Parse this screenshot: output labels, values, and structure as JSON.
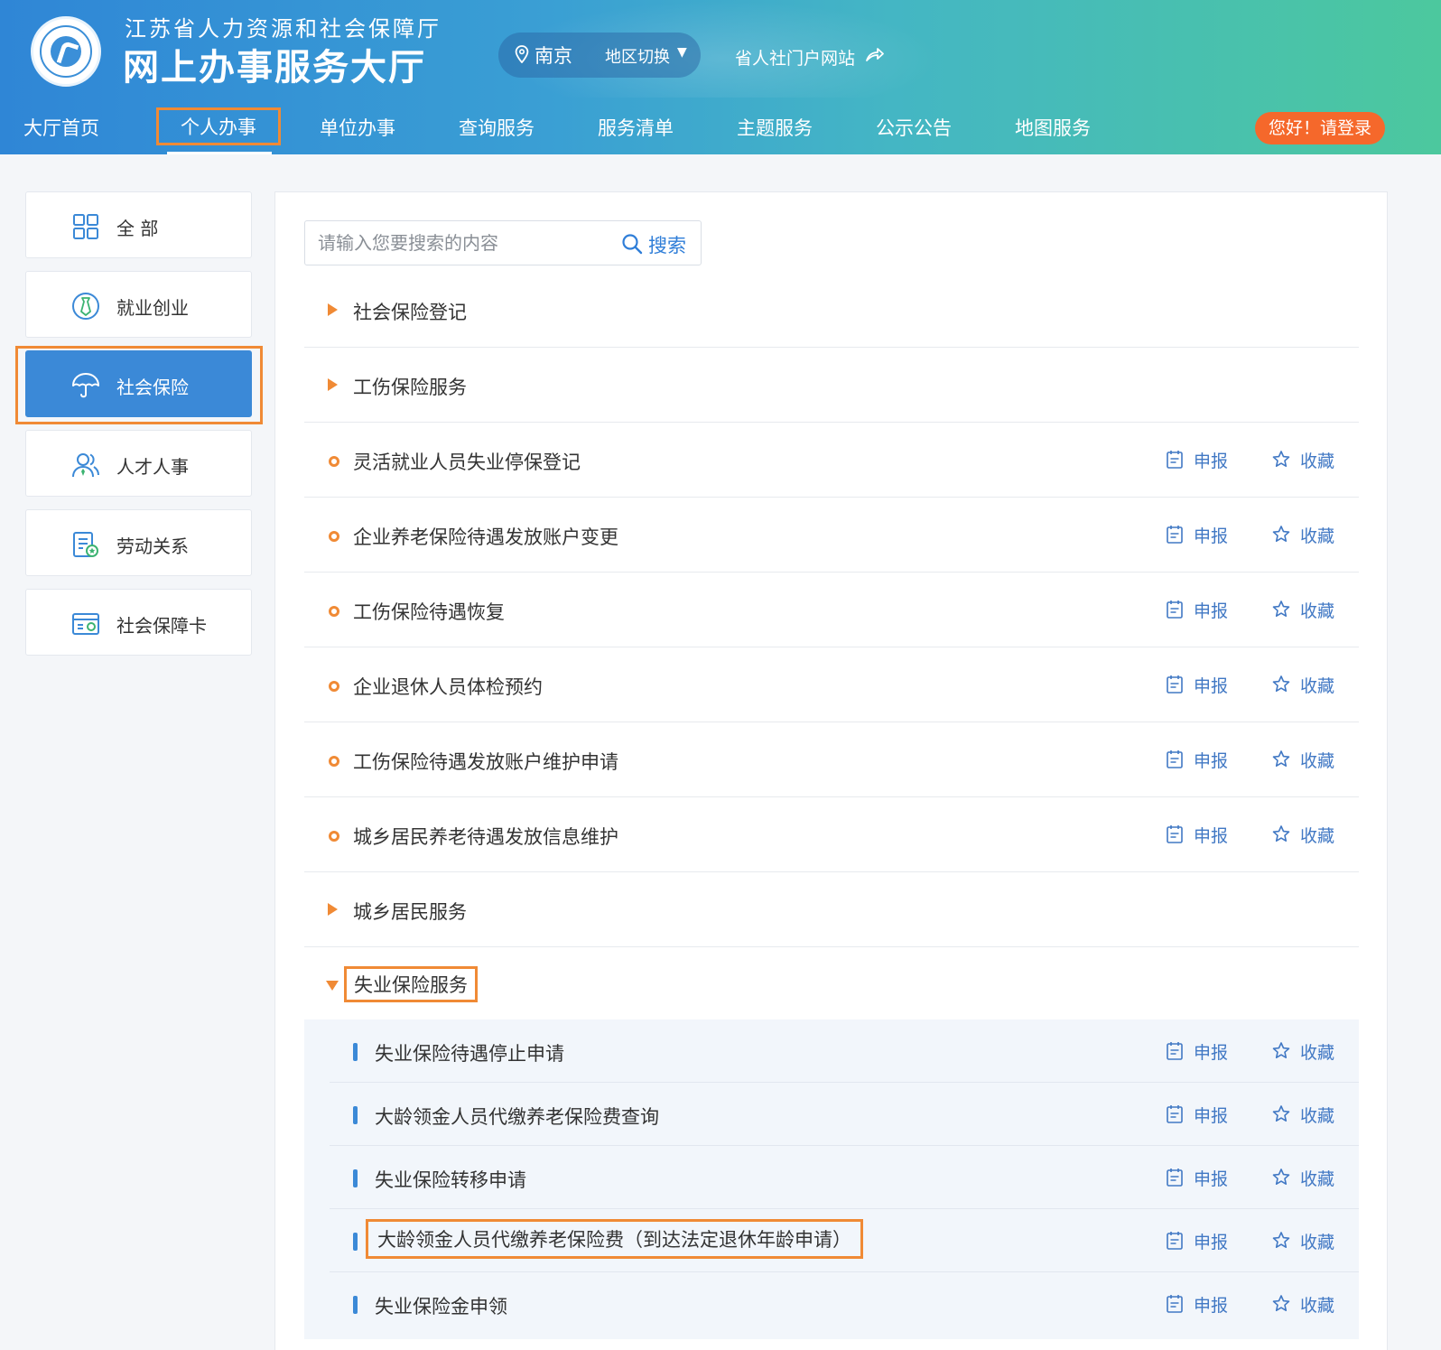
{
  "header": {
    "subtitle": "江苏省人力资源和社会保障厅",
    "title": "网上办事服务大厅",
    "region": {
      "city": "南京",
      "switch_label": "地区切换"
    },
    "portal_link": "省人社门户网站",
    "login": "您好！请登录"
  },
  "nav": {
    "items": [
      "大厅首页",
      "个人办事",
      "单位办事",
      "查询服务",
      "服务清单",
      "主题服务",
      "公示公告",
      "地图服务"
    ],
    "active": "个人办事"
  },
  "sidebar": {
    "items": [
      {
        "label": "全 部",
        "icon": "grid-icon"
      },
      {
        "label": "就业创业",
        "icon": "tie-icon"
      },
      {
        "label": "社会保险",
        "icon": "umbrella-icon"
      },
      {
        "label": "人才人事",
        "icon": "people-icon"
      },
      {
        "label": "劳动关系",
        "icon": "document-icon"
      },
      {
        "label": "社会保障卡",
        "icon": "card-icon"
      }
    ],
    "active": "社会保险"
  },
  "search": {
    "placeholder": "请输入您要搜索的内容",
    "button": "搜索"
  },
  "actions": {
    "declare": "申报",
    "favorite": "收藏"
  },
  "services": [
    {
      "type": "category",
      "label": "社会保险登记",
      "expanded": false
    },
    {
      "type": "category",
      "label": "工伤保险服务",
      "expanded": false
    },
    {
      "type": "item",
      "label": "灵活就业人员失业停保登记"
    },
    {
      "type": "item",
      "label": "企业养老保险待遇发放账户变更"
    },
    {
      "type": "item",
      "label": "工伤保险待遇恢复"
    },
    {
      "type": "item",
      "label": "企业退休人员体检预约"
    },
    {
      "type": "item",
      "label": "工伤保险待遇发放账户维护申请"
    },
    {
      "type": "item",
      "label": "城乡居民养老待遇发放信息维护"
    },
    {
      "type": "category",
      "label": "城乡居民服务",
      "expanded": false
    },
    {
      "type": "category",
      "label": "失业保险服务",
      "expanded": true
    }
  ],
  "sub_services": [
    "失业保险待遇停止申请",
    "大龄领金人员代缴养老保险费查询",
    "失业保险转移申请",
    "大龄领金人员代缴养老保险费（到达法定退休年龄申请）",
    "失业保险金申领"
  ],
  "colors": {
    "accent": "#f08a35",
    "primary": "#3b89d7",
    "login": "#f5682b",
    "link": "#4178c4"
  }
}
